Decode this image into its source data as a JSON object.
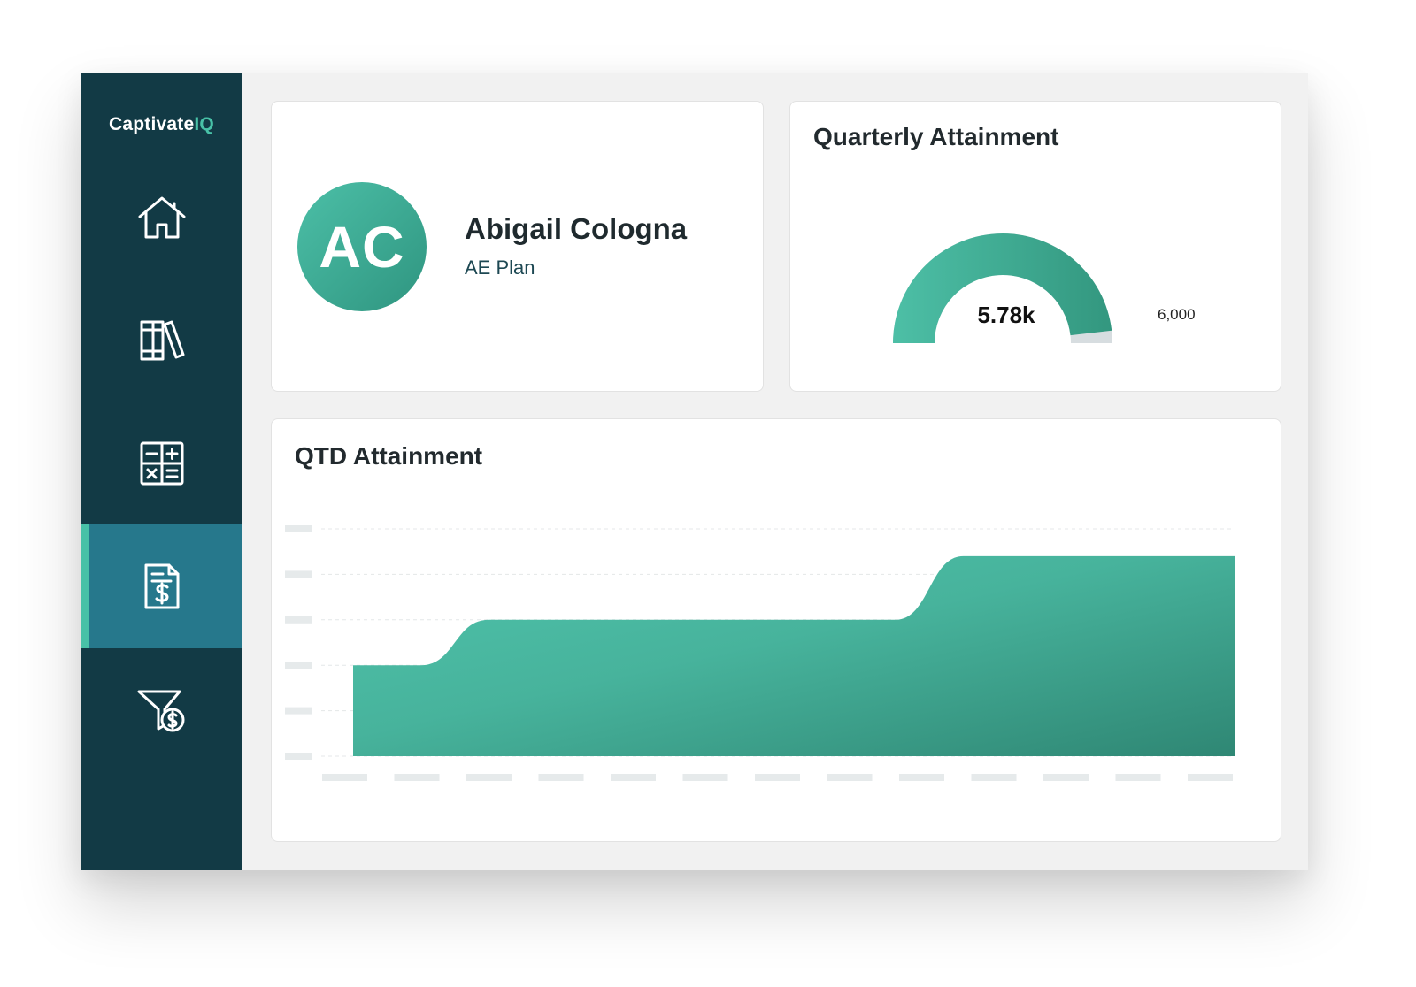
{
  "app": {
    "brand_main": "Captivate",
    "brand_accent": "IQ"
  },
  "sidebar": {
    "items": [
      {
        "icon": "home-icon",
        "active": false
      },
      {
        "icon": "library-icon",
        "active": false
      },
      {
        "icon": "calculator-icon",
        "active": false
      },
      {
        "icon": "invoice-dollar-icon",
        "active": true
      },
      {
        "icon": "filter-dollar-icon",
        "active": false
      }
    ]
  },
  "profile": {
    "initials": "AC",
    "name": "Abigail Cologna",
    "plan": "AE Plan"
  },
  "quarterly": {
    "title": "Quarterly Attainment",
    "value_label": "5.78k",
    "max_label": "6,000",
    "value": 5780,
    "max": 6000
  },
  "chart_data": {
    "type": "area",
    "title": "QTD Attainment",
    "xlabel": "",
    "ylabel": "",
    "x": [
      0,
      1,
      2,
      3,
      4,
      5,
      6,
      7,
      8,
      9,
      10,
      11,
      12,
      13
    ],
    "values": [
      2,
      2,
      3,
      3,
      3,
      3,
      3,
      3,
      3,
      4.4,
      4.4,
      4.4,
      4.4,
      4.4
    ],
    "ylim": [
      0,
      5
    ],
    "grid": true,
    "legend": "none"
  },
  "colors": {
    "sidebar_bg": "#123a45",
    "active_nav_bg": "#26788c",
    "accent": "#48c1a7",
    "teal_dark": "#2f8a77",
    "gauge_remainder": "#d7dde0"
  }
}
